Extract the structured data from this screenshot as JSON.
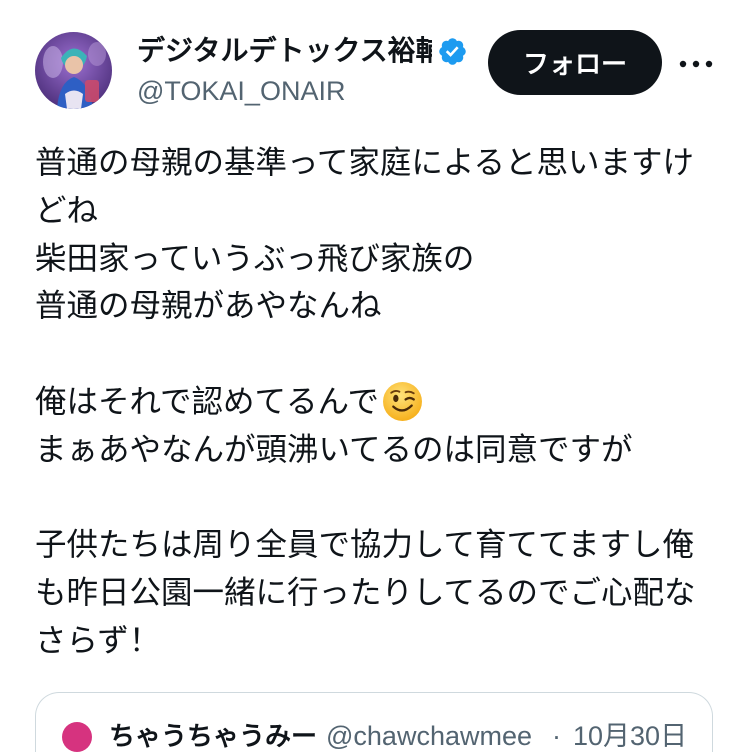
{
  "tweet": {
    "author": {
      "display_name": "デジタルデトックス裕輔",
      "handle": "@TOKAI_ONAIR",
      "avatar_icon": "profile-photo",
      "verified_icon": "verified-badge-icon"
    },
    "follow_label": "フォロー",
    "more_icon": "more-horizontal-icon",
    "body_lines": [
      "普通の母親の基準って家庭によると思いますけ",
      "どね",
      "柴田家っていうぶっ飛び家族の",
      "普通の母親があやなんね",
      "",
      "俺はそれで認めてるんで",
      "まぁあやなんが頭沸いてるのは同意ですが",
      "",
      "子供たちは周り全員で協力して育ててますし俺",
      "も昨日公園一緒に行ったりしてるのでご心配な",
      "さらず！"
    ],
    "emoji_icon": "winking-face-emoji"
  },
  "quoted_tweet": {
    "display_name": "ちゃうちゃうみー",
    "handle": "@chawchawmee",
    "separator": "·",
    "date": "10月30日"
  },
  "colors": {
    "text": "#0f1419",
    "secondary": "#536471",
    "follow_bg": "#0f1419",
    "verified_blue": "#1d9bf0",
    "border": "#cfd9de",
    "quoted_avatar": "#d6337f"
  }
}
